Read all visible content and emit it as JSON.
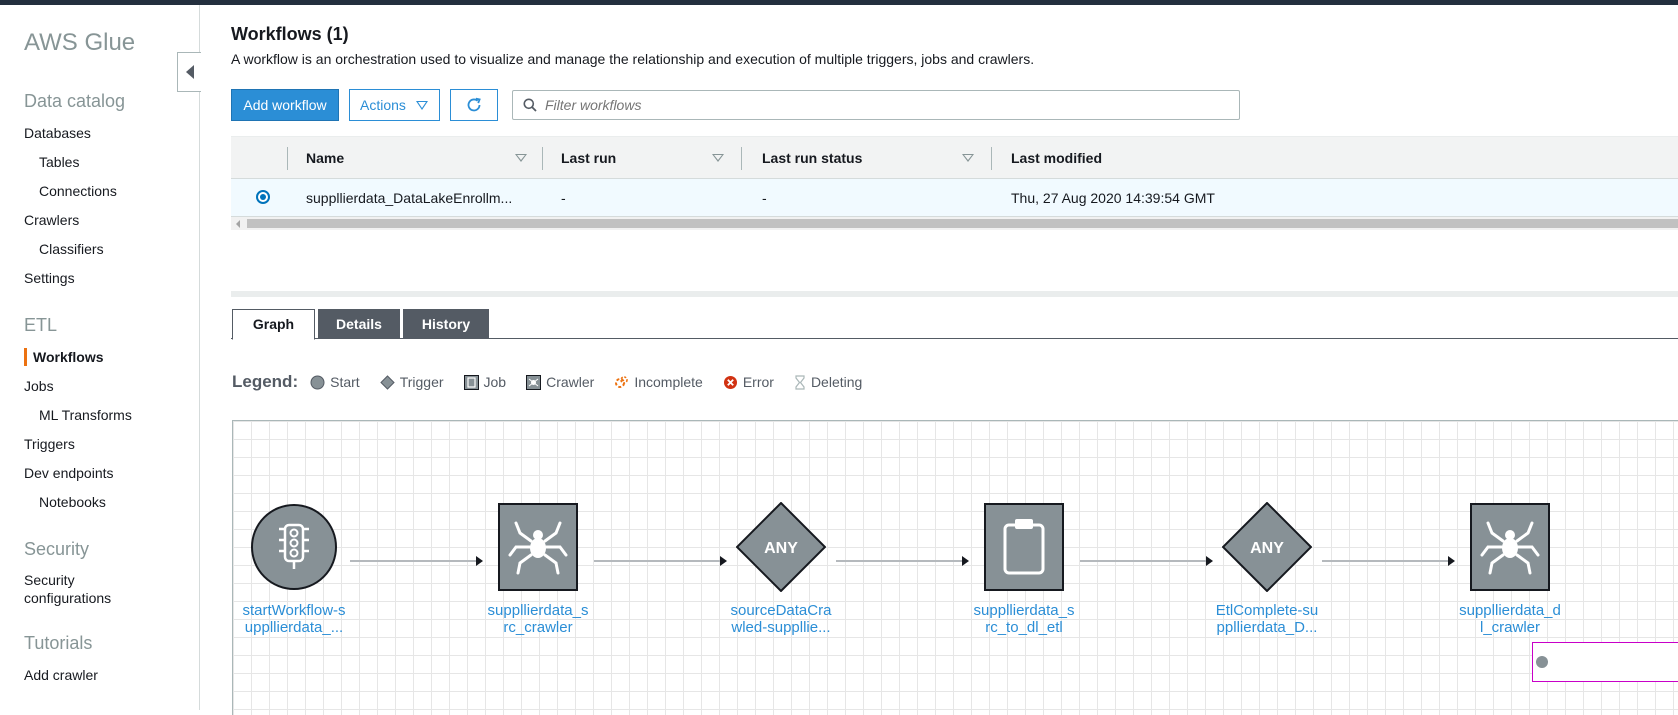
{
  "sidebar": {
    "brand": "AWS Glue",
    "sections": {
      "data_catalog": "Data catalog",
      "etl": "ETL",
      "security": "Security",
      "tutorials": "Tutorials"
    },
    "items": {
      "databases": "Databases",
      "tables": "Tables",
      "connections": "Connections",
      "crawlers": "Crawlers",
      "classifiers": "Classifiers",
      "settings": "Settings",
      "workflows": "Workflows",
      "jobs": "Jobs",
      "ml_transforms": "ML Transforms",
      "triggers": "Triggers",
      "dev_endpoints": "Dev endpoints",
      "notebooks": "Notebooks",
      "security_configurations_1": "Security",
      "security_configurations_2": "configurations",
      "add_crawler": "Add crawler"
    },
    "accent_color": "#ec7211"
  },
  "header": {
    "title": "Workflows (1)",
    "description": "A workflow is an orchestration used to visualize and manage the relationship and execution of multiple triggers, jobs and crawlers."
  },
  "toolbar": {
    "add_workflow": "Add workflow",
    "actions": "Actions",
    "refresh_icon": "refresh-icon",
    "filter_placeholder": "Filter workflows"
  },
  "table": {
    "columns": {
      "name": "Name",
      "last_run": "Last run",
      "last_run_status": "Last run status",
      "last_modified": "Last modified"
    },
    "rows": [
      {
        "name": "suppllierdata_DataLakeEnrollm...",
        "last_run": "-",
        "last_run_status": "-",
        "last_modified": "Thu, 27 Aug 2020 14:39:54 GMT",
        "selected": true
      }
    ]
  },
  "tabs": {
    "graph": "Graph",
    "details": "Details",
    "history": "History"
  },
  "legend": {
    "title": "Legend:",
    "start": "Start",
    "trigger": "Trigger",
    "job": "Job",
    "crawler": "Crawler",
    "incomplete": "Incomplete",
    "error": "Error",
    "deleting": "Deleting"
  },
  "graph": {
    "nodes": [
      {
        "type": "start",
        "label_1": "startWorkflow-s",
        "label_2": "uppllierdata_..."
      },
      {
        "type": "crawler",
        "label_1": "suppllierdata_s",
        "label_2": "rc_crawler"
      },
      {
        "type": "trigger",
        "text": "ANY",
        "label_1": "sourceDataCra",
        "label_2": "wled-suppllie..."
      },
      {
        "type": "job",
        "label_1": "suppllierdata_s",
        "label_2": "rc_to_dl_etl"
      },
      {
        "type": "trigger",
        "text": "ANY",
        "label_1": "EtlComplete-su",
        "label_2": "ppllierdata_D..."
      },
      {
        "type": "crawler",
        "label_1": "suppllierdata_d",
        "label_2": "l_crawler"
      }
    ],
    "node_color": "#879196",
    "link_color": "#2b8ed6"
  }
}
